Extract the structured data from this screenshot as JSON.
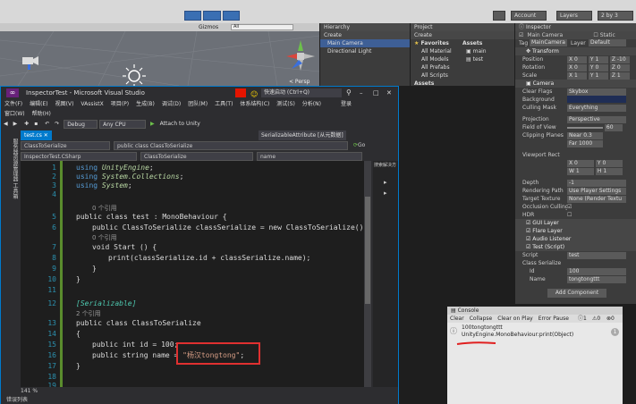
{
  "unity_toolbar": {
    "account": "Account",
    "layers": "Layers",
    "layout": "2 by 3"
  },
  "scene": {
    "tab_gizmos": "Gizmos",
    "tab_search": "All",
    "persp": "< Persp"
  },
  "hierarchy": {
    "title": "Hierarchy",
    "create": "Create",
    "items": [
      "Main Camera",
      "Directional Light"
    ]
  },
  "project": {
    "title": "Project",
    "create": "Create",
    "favorites": "Favorites",
    "fav_items": [
      "All Material",
      "All Models",
      "All Prefabs",
      "All Scripts"
    ],
    "assets_label": "Assets",
    "assets_header": "Assets",
    "asset_items": [
      "main",
      "test"
    ]
  },
  "vs": {
    "title": "InspectorTest - Microsoft Visual Studio",
    "quick_launch": "快速启动 (Ctrl+Q)",
    "user": "登录",
    "menu": [
      "文件(F)",
      "编辑(E)",
      "视图(V)",
      "VAssistX",
      "项目(P)",
      "生成(B)",
      "调试(D)",
      "团队(M)",
      "工具(T)",
      "体系结构(C)",
      "测试(S)",
      "分析(N)",
      "窗口(W)",
      "帮助(H)"
    ],
    "config": "Debug",
    "platform": "Any CPU",
    "attach": "Attach to Unity",
    "file_tab": "test.cs",
    "right_tab": "SerializableAttribute [从元数据]",
    "nav_class": "ClassToSerialize",
    "nav_member": "public class ClassToSerialize",
    "go": "Go",
    "nav2_project": "InspectorTest.CSharp",
    "nav2_class": "ClassToSerialize",
    "nav2_member": "name",
    "solution_label": "搜索解决方",
    "left_strip": "服务器资源管理器 工具箱",
    "zoom": "141 %",
    "error_list": "错误列表"
  },
  "code": {
    "line_numbers": [
      "1",
      "2",
      "3",
      "4",
      "5",
      "6",
      "7",
      "8",
      "9",
      "10",
      "11",
      "12",
      "13",
      "14",
      "15",
      "16",
      "17",
      "18",
      "19"
    ],
    "using1_kw": "using",
    "using1_ns": "UnityEngine",
    "using2_ns": "System.Collections",
    "using3_ns": "System",
    "refs0": "0 个引用",
    "refs0b": "0 个引用",
    "refs2": "2 个引用",
    "class_test": "public class test : MonoBehaviour {",
    "field_line": "public ClassToSerialize classSerialize = new ClassToSerialize();",
    "start_line": "void Start () {",
    "print_line": "print(classSerialize.id + classSerialize.name);",
    "attr": "[Serializable]",
    "class2": "public class ClassToSerialize",
    "id_line": "public int id = 100;",
    "name_decl": "public string name = ",
    "name_value": "\"杨汉tongtong\"",
    "semicolon": ";"
  },
  "inspector": {
    "title": "Inspector",
    "object_name": "Main Camera",
    "static": "Static",
    "tag_label": "Tag",
    "tag_value": "MainCamera",
    "layer_label": "Layer",
    "layer_value": "Default",
    "transform": "Transform",
    "position": {
      "label": "Position",
      "x": "X 0",
      "y": "Y 1",
      "z": "Z -10"
    },
    "rotation": {
      "label": "Rotation",
      "x": "X 0",
      "y": "Y 0",
      "z": "Z 0"
    },
    "scale": {
      "label": "Scale",
      "x": "X 1",
      "y": "Y 1",
      "z": "Z 1"
    },
    "camera": "Camera",
    "clear_flags": {
      "label": "Clear Flags",
      "value": "Skybox"
    },
    "background": {
      "label": "Background"
    },
    "culling_mask": {
      "label": "Culling Mask",
      "value": "Everything"
    },
    "projection": {
      "label": "Projection",
      "value": "Perspective"
    },
    "fov": {
      "label": "Field of View",
      "value": "60"
    },
    "clipping": {
      "label": "Clipping Planes",
      "near": "Near 0.3",
      "far": "Far 1000"
    },
    "viewport": {
      "label": "Viewport Rect",
      "x": "X 0",
      "y": "Y 0",
      "w": "W 1",
      "h": "H 1"
    },
    "depth": {
      "label": "Depth",
      "value": "-1"
    },
    "rendering_path": {
      "label": "Rendering Path",
      "value": "Use Player Settings"
    },
    "target_texture": {
      "label": "Target Texture",
      "value": "None (Render Textu"
    },
    "occlusion": {
      "label": "Occlusion Culling"
    },
    "hdr": {
      "label": "HDR"
    },
    "gui_layer": "GUI Layer",
    "flare_layer": "Flare Layer",
    "audio_listener": "Audio Listener",
    "test_script": "Test (Script)",
    "script": {
      "label": "Script",
      "value": "test"
    },
    "class_serialize": "Class Serialize",
    "id": {
      "label": "Id",
      "value": "100"
    },
    "name": {
      "label": "Name",
      "value": "tongtongttt"
    },
    "add_component": "Add Component"
  },
  "console": {
    "title": "Console",
    "buttons": [
      "Clear",
      "Collapse",
      "Clear on Play",
      "Error Pause"
    ],
    "counts": [
      "1",
      "0",
      "0"
    ],
    "log_line1": "100tongtongttt",
    "log_line2": "UnityEngine.MonoBehaviour:print(Object)",
    "log_count": "1"
  }
}
